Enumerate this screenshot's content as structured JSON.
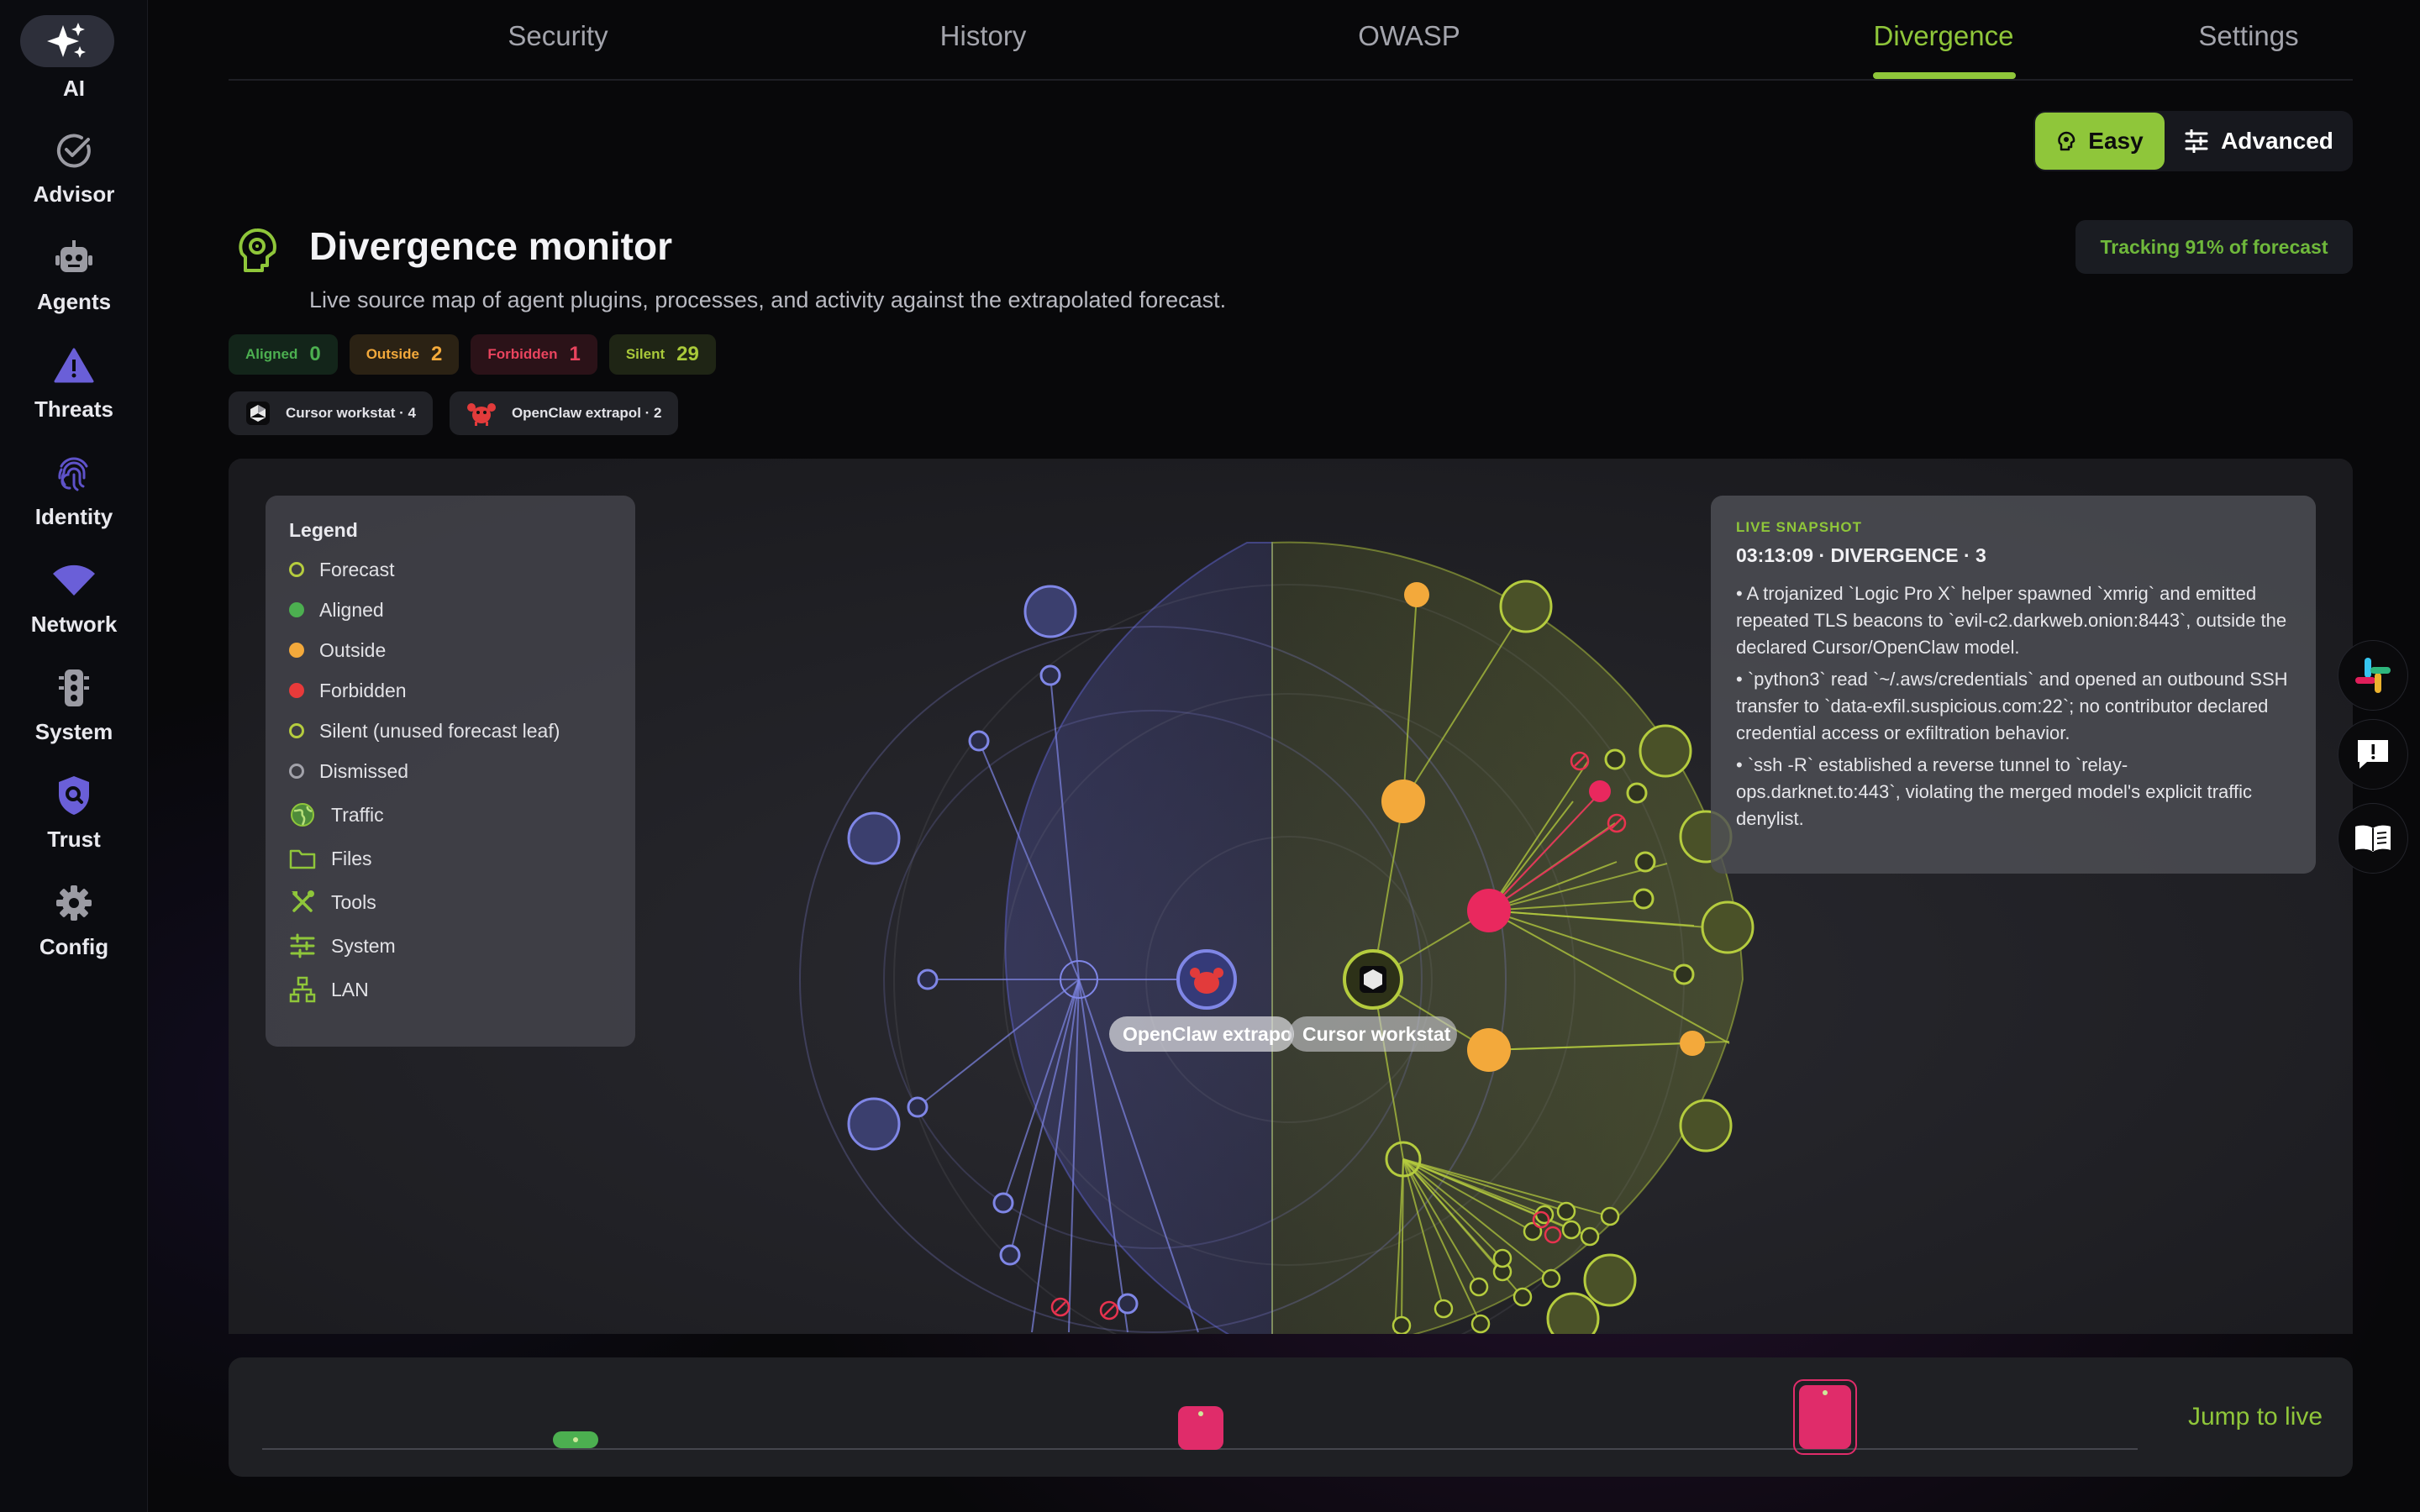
{
  "sidebar": {
    "items": [
      {
        "label": "AI",
        "icon": "sparkles-icon",
        "active": true
      },
      {
        "label": "Advisor",
        "icon": "check-circle-icon"
      },
      {
        "label": "Agents",
        "icon": "robot-icon"
      },
      {
        "label": "Threats",
        "icon": "warning-triangle-icon"
      },
      {
        "label": "Identity",
        "icon": "fingerprint-icon"
      },
      {
        "label": "Network",
        "icon": "wifi-icon"
      },
      {
        "label": "System",
        "icon": "traffic-light-icon"
      },
      {
        "label": "Trust",
        "icon": "shield-icon"
      },
      {
        "label": "Config",
        "icon": "gear-icon"
      }
    ]
  },
  "tabs": [
    "Security",
    "History",
    "OWASP",
    "Divergence",
    "Settings"
  ],
  "active_tab": "Divergence",
  "mode": {
    "easy": "Easy",
    "advanced": "Advanced"
  },
  "header": {
    "title": "Divergence monitor",
    "subtitle": "Live source map of agent plugins, processes, and activity against the extrapolated forecast.",
    "tracking": "Tracking 91% of forecast"
  },
  "counts": {
    "aligned": {
      "label": "Aligned",
      "value": "0"
    },
    "outside": {
      "label": "Outside",
      "value": "2"
    },
    "forbidden": {
      "label": "Forbidden",
      "value": "1"
    },
    "silent": {
      "label": "Silent",
      "value": "29"
    }
  },
  "agents": [
    {
      "label": "Cursor workstat · 4"
    },
    {
      "label": "OpenClaw extrapol · 2"
    }
  ],
  "legend": {
    "title": "Legend",
    "items": [
      "Forecast",
      "Aligned",
      "Outside",
      "Forbidden",
      "Silent (unused forecast leaf)",
      "Dismissed"
    ],
    "categories": [
      "Traffic",
      "Files",
      "Tools",
      "System",
      "LAN"
    ]
  },
  "snapshot": {
    "tag": "LIVE SNAPSHOT",
    "heading": "03:13:09 · DIVERGENCE · 3",
    "items": [
      "• A trojanized `Logic Pro X` helper spawned `xmrig` and emitted repeated TLS beacons to `evil-c2.darkweb.onion:8443`, outside the declared Cursor/OpenClaw model.",
      "• `python3` read `~/.aws/credentials` and opened an outbound SSH transfer to `data-exfil.suspicious.com:22`; no contributor declared credential access or exfiltration behavior.",
      "• `ssh -R` established a reverse tunnel to `relay-ops.darknet.to:443`, violating the merged model's explicit traffic denylist."
    ]
  },
  "node_labels": {
    "openclaw": "OpenClaw extrapol",
    "cursor": "Cursor workstat"
  },
  "timeline": {
    "jump": "Jump to live"
  },
  "colors": {
    "accent": "#8fc63a",
    "aligned": "#4caf50",
    "outside": "#f3a93b",
    "forbidden": "#e9285e",
    "silent": "#b5cc3e",
    "dismissed": "#9b9ba3",
    "openclaw_sector": "#5b5fc7"
  }
}
